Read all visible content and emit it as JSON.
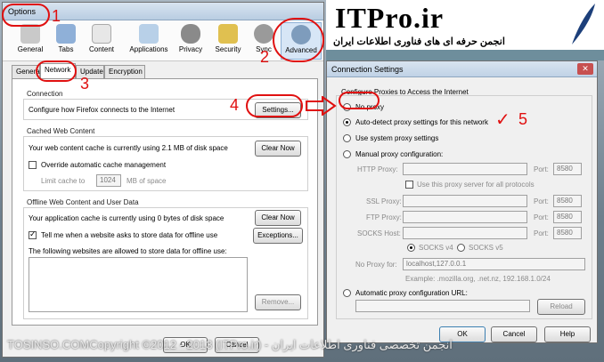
{
  "options_window": {
    "title": "Options",
    "toolbar": [
      {
        "label": "General",
        "icon": "switch-icon"
      },
      {
        "label": "Tabs",
        "icon": "tabs-icon"
      },
      {
        "label": "Content",
        "icon": "content-icon"
      },
      {
        "label": "Applications",
        "icon": "applications-icon"
      },
      {
        "label": "Privacy",
        "icon": "privacy-mask-icon"
      },
      {
        "label": "Security",
        "icon": "lock-icon"
      },
      {
        "label": "Sync",
        "icon": "sync-icon"
      },
      {
        "label": "Advanced",
        "icon": "gear-icon"
      }
    ],
    "tabs": [
      "General",
      "Network",
      "Update",
      "Encryption"
    ],
    "connection": {
      "title": "Connection",
      "desc": "Configure how Firefox connects to the Internet",
      "button": "Settings..."
    },
    "cache": {
      "title": "Cached Web Content",
      "desc": "Your web content cache is currently using 2.1 MB of disk space",
      "clear": "Clear Now",
      "override": "Override automatic cache management",
      "limit": "Limit cache to",
      "limit_value": "1024",
      "unit": "MB of space"
    },
    "offline": {
      "title": "Offline Web Content and User Data",
      "desc": "Your application cache is currently using 0 bytes of disk space",
      "clear": "Clear Now",
      "tell": "Tell me when a website asks to store data for offline use",
      "exceptions": "Exceptions...",
      "allowed": "The following websites are allowed to store data for offline use:",
      "remove": "Remove..."
    },
    "ok": "OK",
    "cancel": "Cancel"
  },
  "connection_settings": {
    "title": "Connection Settings",
    "heading": "Configure Proxies to Access the Internet",
    "options": [
      "No proxy",
      "Auto-detect proxy settings for this network",
      "Use system proxy settings",
      "Manual proxy configuration:"
    ],
    "http_proxy": "HTTP Proxy:",
    "port": "Port:",
    "port_value": "8580",
    "same_proxy": "Use this proxy server for all protocols",
    "ssl": "SSL Proxy:",
    "ftp": "FTP Proxy:",
    "socks": "SOCKS Host:",
    "socks_v4": "SOCKS v4",
    "socks_v5": "SOCKS v5",
    "no_proxy_for": "No Proxy for:",
    "no_proxy_value": "localhost,127.0.0.1",
    "example": "Example: .mozilla.org, .net.nz, 192.168.1.0/24",
    "auto_url": "Automatic proxy configuration URL:",
    "reload": "Reload",
    "ok": "OK",
    "cancel": "Cancel",
    "help": "Help"
  },
  "header": {
    "logo": "ITPro.ir",
    "subtitle": "انجمن حرفه ای های فناوری اطلاعات ایران"
  },
  "annotations": [
    "1",
    "2",
    "3",
    "4",
    "5"
  ],
  "watermark": "TOSINSO.COMCopyright ©2012 - 2013 (ITPro.ir) - انجمن تخصصی فناوری اطلاعات ایران"
}
